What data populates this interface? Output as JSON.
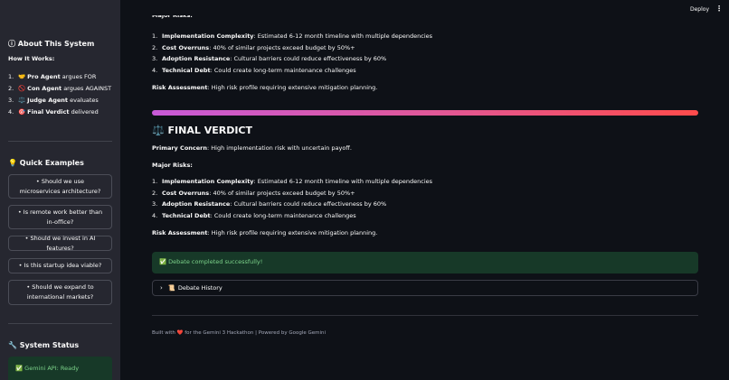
{
  "sidebar": {
    "about_title": "About This System",
    "how_title": "How It Works:",
    "steps": [
      {
        "num": "1.",
        "icon": "🤝",
        "label": "Pro Agent",
        "desc": "argues FOR"
      },
      {
        "num": "2.",
        "icon": "🚫",
        "label": "Con Agent",
        "desc": "argues AGAINST"
      },
      {
        "num": "3.",
        "icon": "⚖️",
        "label": "Judge Agent",
        "desc": "evaluates"
      },
      {
        "num": "4.",
        "icon": "🎯",
        "label": "Final Verdict",
        "desc": "delivered"
      }
    ],
    "examples_title": "Quick Examples",
    "examples": [
      "• Should we use microservices architecture?",
      "• Is remote work better than in-office?",
      "• Should we invest in AI features?",
      "• Is this startup idea viable?",
      "• Should we expand to international markets?"
    ],
    "status_title": "System Status",
    "status_value": "Gemini API: Ready"
  },
  "topbar": {
    "deploy": "Deploy",
    "menu": "⋮"
  },
  "upper": {
    "clipped_heading": "Major Risks:",
    "risks": [
      {
        "n": "1.",
        "label": "Implementation Complexity",
        "text": ": Estimated 6-12 month timeline with multiple dependencies"
      },
      {
        "n": "2.",
        "label": "Cost Overruns",
        "text": ": 40% of similar projects exceed budget by 50%+"
      },
      {
        "n": "3.",
        "label": "Adoption Resistance",
        "text": ": Cultural barriers could reduce effectiveness by 60%"
      },
      {
        "n": "4.",
        "label": "Technical Debt",
        "text": ": Could create long-term maintenance challenges"
      }
    ],
    "assessment_label": "Risk Assessment",
    "assessment_text": ": High risk profile requiring extensive mitigation planning."
  },
  "verdict": {
    "icon": "⚖️",
    "title": "FINAL VERDICT",
    "concern_label": "Primary Concern",
    "concern_text": ": High implementation risk with uncertain payoff.",
    "risks_heading": "Major Risks:",
    "risks": [
      {
        "n": "1.",
        "label": "Implementation Complexity",
        "text": ": Estimated 6-12 month timeline with multiple dependencies"
      },
      {
        "n": "2.",
        "label": "Cost Overruns",
        "text": ": 40% of similar projects exceed budget by 50%+"
      },
      {
        "n": "3.",
        "label": "Adoption Resistance",
        "text": ": Cultural barriers could reduce effectiveness by 60%"
      },
      {
        "n": "4.",
        "label": "Technical Debt",
        "text": ": Could create long-term maintenance challenges"
      }
    ],
    "assessment_label": "Risk Assessment",
    "assessment_text": ": High risk profile requiring extensive mitigation planning."
  },
  "success_message": "✅ Debate completed successfully!",
  "expander": {
    "icon": "📜",
    "label": "Debate History"
  },
  "footer": {
    "before": "Built with ",
    "heart": "❤️",
    "after": " for the Gemini 3 Hackathon | Powered by Google Gemini"
  },
  "colors": {
    "background": "#0e1117",
    "sidebar": "#262730",
    "success_bg": "#173928",
    "success_text": "#7cd38a"
  }
}
